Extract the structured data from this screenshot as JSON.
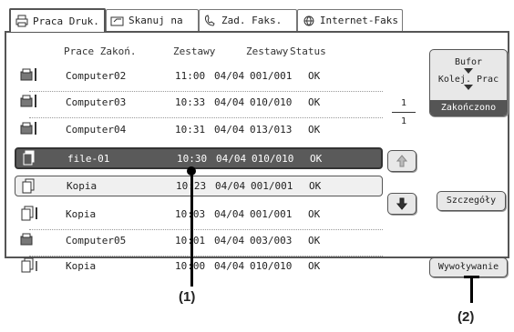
{
  "tabs": [
    {
      "label": "Praca Druk.",
      "icon": "printer-icon"
    },
    {
      "label": "Skanuj na",
      "icon": "scanner-icon"
    },
    {
      "label": "Zad. Faks.",
      "icon": "fax-icon"
    },
    {
      "label": "Internet-Faks",
      "icon": "internet-fax-icon"
    }
  ],
  "headers": {
    "prace": "Prace Zakoń.",
    "zestawy1": "Zestawy",
    "zestawy2": "Zestawy",
    "status": "Status"
  },
  "jobs": [
    {
      "name": "Computer02",
      "time": "11:00",
      "date": "04/04",
      "sets": "001/001",
      "status": "OK",
      "icon": "computer-icon"
    },
    {
      "name": "Computer03",
      "time": "10:33",
      "date": "04/04",
      "sets": "010/010",
      "status": "OK",
      "icon": "computer-icon"
    },
    {
      "name": "Computer04",
      "time": "10:31",
      "date": "04/04",
      "sets": "013/013",
      "status": "OK",
      "icon": "computer-icon"
    },
    {
      "name": "file-01",
      "time": "10:30",
      "date": "04/04",
      "sets": "010/010",
      "status": "OK",
      "icon": "file-icon"
    },
    {
      "name": "Kopia",
      "time": "10:23",
      "date": "04/04",
      "sets": "001/001",
      "status": "OK",
      "icon": "copy-icon"
    },
    {
      "name": "Kopia",
      "time": "10:03",
      "date": "04/04",
      "sets": "001/001",
      "status": "OK",
      "icon": "copy-icon"
    },
    {
      "name": "Computer05",
      "time": "10:01",
      "date": "04/04",
      "sets": "003/003",
      "status": "OK",
      "icon": "computer-icon"
    },
    {
      "name": "Kopia",
      "time": "10:00",
      "date": "04/04",
      "sets": "010/010",
      "status": "OK",
      "icon": "copy-icon"
    }
  ],
  "page": {
    "current": "1",
    "total": "1"
  },
  "side": {
    "bufor": "Bufor",
    "kolej": "Kolej. Prac",
    "zakonczono": "Zakończono",
    "szczegoly": "Szczegóły",
    "wywolywanie": "Wywoływanie"
  },
  "callouts": {
    "one": "(1)",
    "two": "(2)"
  },
  "colors": {
    "selected_row": "#5a5a5a",
    "accent_dark": "#555555"
  }
}
